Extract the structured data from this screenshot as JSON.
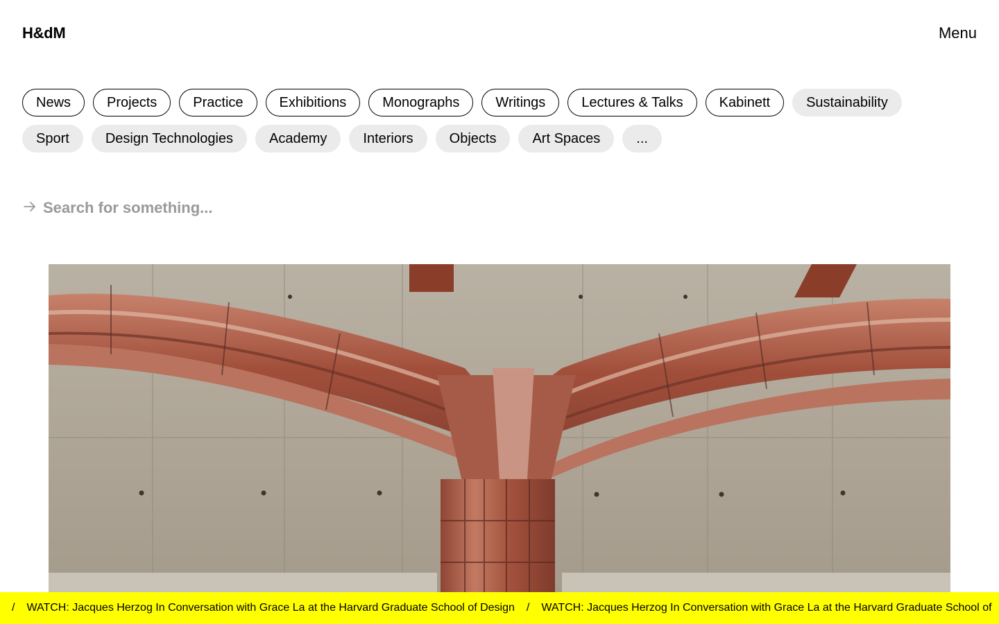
{
  "header": {
    "logo": "H&dM",
    "menu_label": "Menu"
  },
  "filters": [
    {
      "label": "News",
      "selected": true
    },
    {
      "label": "Projects",
      "selected": true
    },
    {
      "label": "Practice",
      "selected": true
    },
    {
      "label": "Exhibitions",
      "selected": true
    },
    {
      "label": "Monographs",
      "selected": true
    },
    {
      "label": "Writings",
      "selected": true
    },
    {
      "label": "Lectures & Talks",
      "selected": true
    },
    {
      "label": "Kabinett",
      "selected": true
    },
    {
      "label": "Sustainability",
      "selected": false
    },
    {
      "label": "Sport",
      "selected": false
    },
    {
      "label": "Design Technologies",
      "selected": false
    },
    {
      "label": "Academy",
      "selected": false
    },
    {
      "label": "Interiors",
      "selected": false
    },
    {
      "label": "Objects",
      "selected": false
    },
    {
      "label": "Art Spaces",
      "selected": false
    },
    {
      "label": "...",
      "selected": false
    }
  ],
  "search": {
    "placeholder": "Search for something...",
    "value": "",
    "icon": "arrow-right-icon"
  },
  "ticker": {
    "separator": "/",
    "items": [
      "WATCH: Jacques Herzog In Conversation with Grace La at the Harvard Graduate School of Design",
      "WATCH: Jacques Herzog In Conversation with Grace La at the Harvard Graduate School of"
    ]
  },
  "colors": {
    "ticker_bg": "#ffff00",
    "pill_muted": "#ebebeb",
    "placeholder": "#999999"
  }
}
